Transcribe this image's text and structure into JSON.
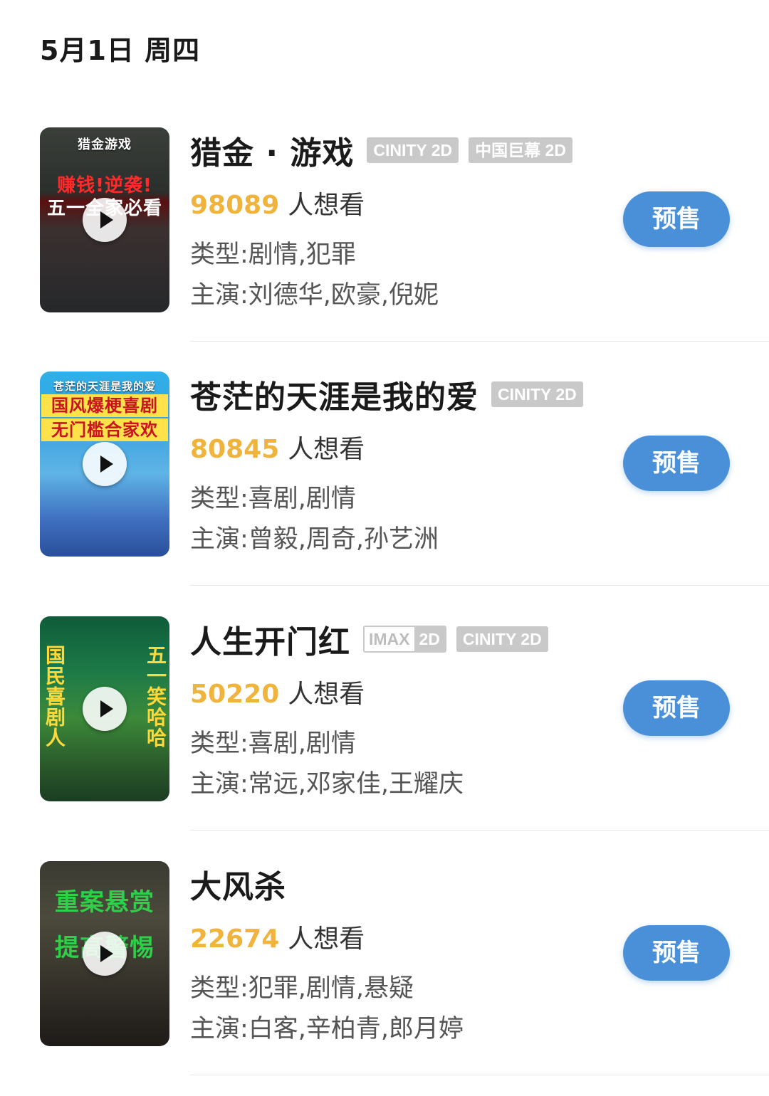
{
  "date_header": "5月1日 周四",
  "presale_label": "预售",
  "want_suffix": "人想看",
  "colors": {
    "want_count": "#f0b43c",
    "presale_button": "#4a90d9",
    "format_tag": "#c9c9c9"
  },
  "movies": [
    {
      "title": "猎金 · 游戏",
      "formats": [
        "CINITY 2D",
        "中国巨幕 2D"
      ],
      "want_count": "98089",
      "genre": "类型:剧情,犯罪",
      "cast": "主演:刘德华,欧豪,倪妮",
      "poster": {
        "caption": "猎金游戏",
        "slogan_line1": "赚钱!逆袭!",
        "slogan_line2": "五一全家必看"
      }
    },
    {
      "title": "苍茫的天涯是我的爱",
      "formats": [
        "CINITY 2D"
      ],
      "want_count": "80845",
      "genre": "类型:喜剧,剧情",
      "cast": "主演:曾毅,周奇,孙艺洲",
      "poster": {
        "caption": "苍茫的天涯是我的爱",
        "slogan_line1": "国风爆梗喜剧",
        "slogan_line2": "无门槛合家欢"
      }
    },
    {
      "title": "人生开门红",
      "formats": [
        "IMAX 2D",
        "CINITY 2D"
      ],
      "imax": {
        "left": "IMAX",
        "right": "2D"
      },
      "want_count": "50220",
      "genre": "类型:喜剧,剧情",
      "cast": "主演:常远,邓家佳,王耀庆",
      "poster": {
        "caption": "",
        "slogan_line1": "国民喜剧人",
        "slogan_line2": "五一笑哈哈"
      }
    },
    {
      "title": "大风杀",
      "formats": [],
      "want_count": "22674",
      "genre": "类型:犯罪,剧情,悬疑",
      "cast": "主演:白客,辛柏青,郎月婷",
      "poster": {
        "caption": "",
        "slogan_line1": "重案悬赏",
        "slogan_line2": "提高警惕"
      }
    }
  ]
}
